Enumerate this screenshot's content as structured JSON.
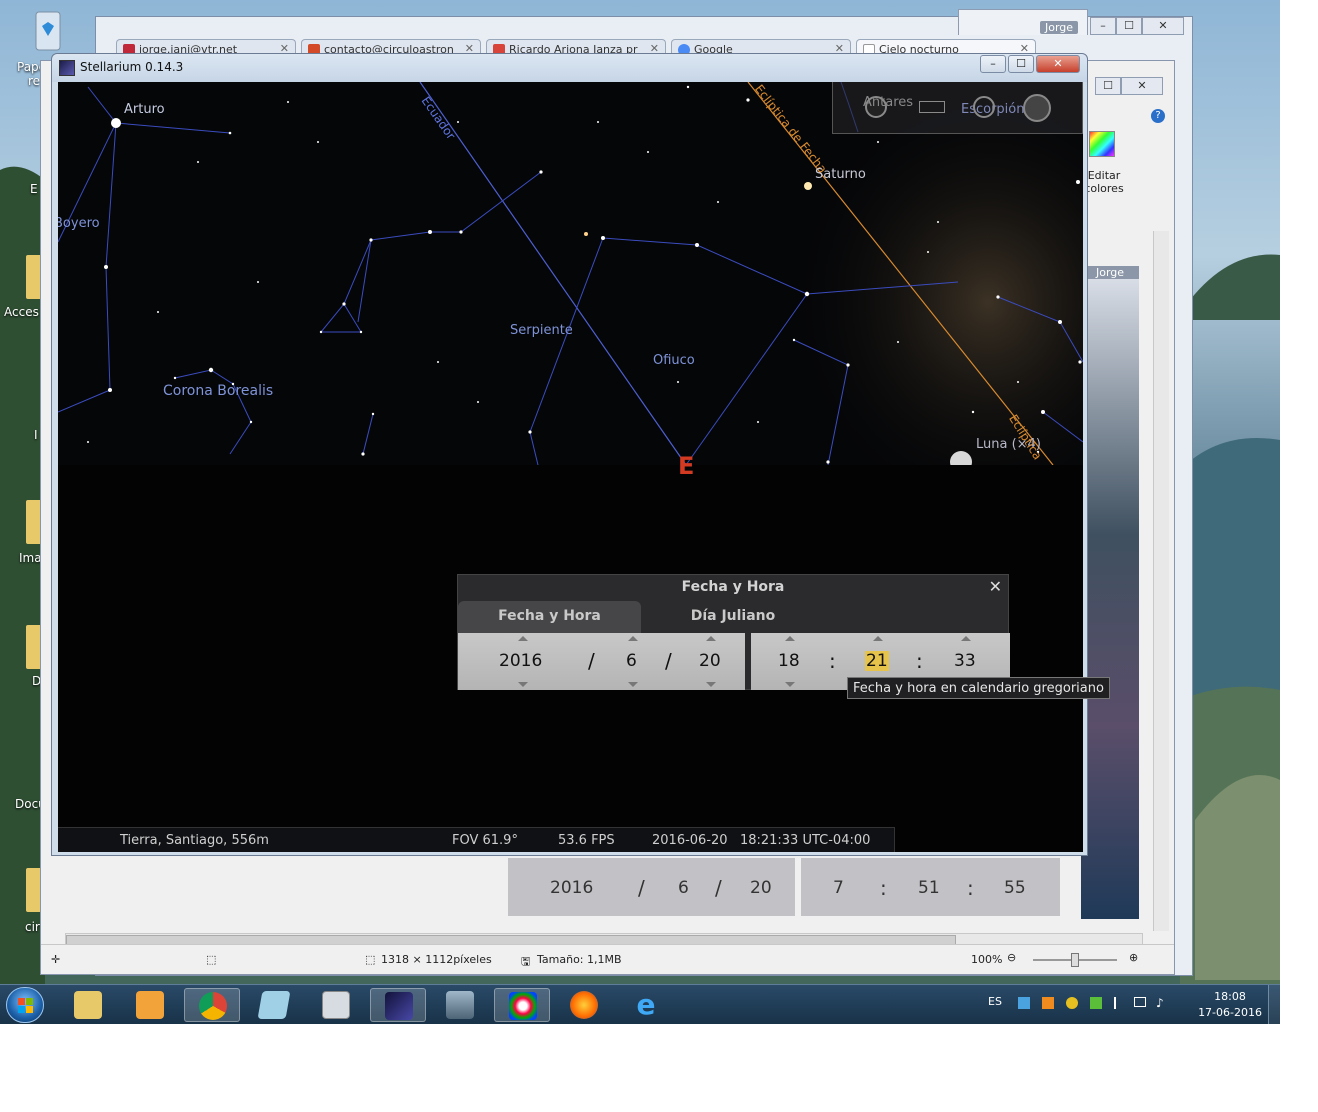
{
  "desktop": {
    "labels": [
      "Papel",
      "re",
      "E",
      "Acces",
      "I",
      "Ima",
      "D",
      "Docu",
      "D",
      "cir"
    ]
  },
  "browser": {
    "tabs": [
      {
        "label": "jorge.jani@vtr.net",
        "color": "#c0283a"
      },
      {
        "label": "contacto@circuloastron",
        "color": "#d24a28"
      },
      {
        "label": "Ricardo Ariona Ianza pr",
        "color": "#d9443a"
      },
      {
        "label": "Google",
        "color": "#4a8af4"
      },
      {
        "label": "Cielo nocturno",
        "color": "#999999"
      }
    ],
    "user": "Jorge",
    "user2": "Jorge"
  },
  "paint": {
    "edit_colors": "Editar colores",
    "status_size": "1318 × 1112píxeles",
    "status_filesize": "Tamaño: 1,1MB",
    "zoom": "100%"
  },
  "stellarium": {
    "title": "Stellarium 0.14.3",
    "sky_labels": {
      "arturo": "Arturo",
      "boyero": "Boyero",
      "ecuador": "Ecuador",
      "ecliptica_fecha": "Eclíptica de Fecha",
      "saturno": "Saturno",
      "antares": "Antares",
      "escorpion": "Escorpión",
      "serpiente": "Serpiente",
      "ofiuco": "Ofiuco",
      "corona": "Corona Borealis",
      "luna": "Luna (×4)",
      "ecliptica": "Eclíptica",
      "cardinal": "E"
    },
    "status": {
      "location": "Tierra, Santiago, 556m",
      "fov": "FOV 61.9°",
      "fps": "53.6 FPS",
      "datetime": "2016-06-20   18:21:33 UTC-04:00"
    }
  },
  "dialog": {
    "title": "Fecha y Hora",
    "tabs": [
      "Fecha y Hora",
      "Día Juliano"
    ],
    "year": "2016",
    "month": "6",
    "day": "20",
    "hour": "18",
    "minute": "21",
    "second": "33",
    "date_sep": "/",
    "time_sep": ":",
    "tooltip": "Fecha y hora en calendario gregoriano"
  },
  "ghost_dialog": {
    "year": "2016",
    "month": "6",
    "day": "20",
    "hour": "7",
    "minute": "51",
    "second": "55"
  },
  "taskbar": {
    "lang": "ES",
    "time": "18:08",
    "date": "17-06-2016"
  }
}
